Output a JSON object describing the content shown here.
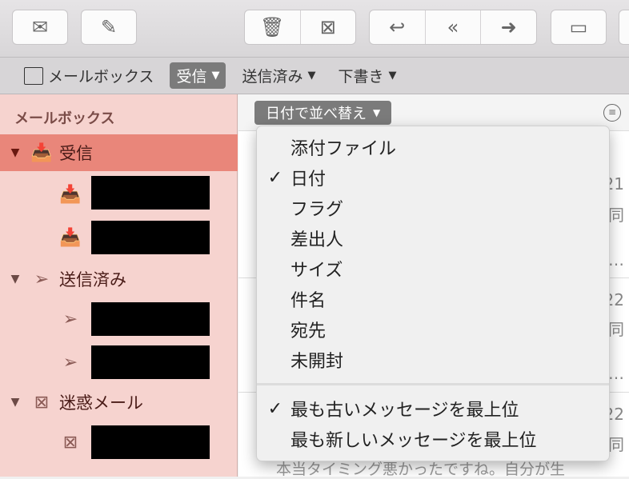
{
  "toolbar": {
    "buttons": [
      "mail-icon",
      "compose-icon",
      "trash-icon",
      "junk-icon",
      "reply-icon",
      "reply-all-icon",
      "forward-icon",
      "archive-icon"
    ]
  },
  "favorites": {
    "mailboxes": "メールボックス",
    "inbox": "受信",
    "sent": "送信済み",
    "drafts": "下書き"
  },
  "sidebar": {
    "heading": "メールボックス",
    "inbox": "受信",
    "sent": "送信済み",
    "junk": "迷惑メール"
  },
  "list": {
    "sort_label": "日付で並べ替え",
    "peek": [
      "21",
      "同",
      "…",
      "22",
      "同",
      "…",
      "22",
      "同"
    ],
    "bottom_preview": "本当タイミング悪かったですね。自分が生"
  },
  "sort_menu": {
    "items": [
      {
        "label": "添付ファイル",
        "checked": false
      },
      {
        "label": "日付",
        "checked": true
      },
      {
        "label": "フラグ",
        "checked": false
      },
      {
        "label": "差出人",
        "checked": false
      },
      {
        "label": "サイズ",
        "checked": false
      },
      {
        "label": "件名",
        "checked": false
      },
      {
        "label": "宛先",
        "checked": false
      },
      {
        "label": "未開封",
        "checked": false
      }
    ],
    "order": [
      {
        "label": "最も古いメッセージを最上位",
        "checked": true
      },
      {
        "label": "最も新しいメッセージを最上位",
        "checked": false
      }
    ],
    "check": "✓"
  }
}
